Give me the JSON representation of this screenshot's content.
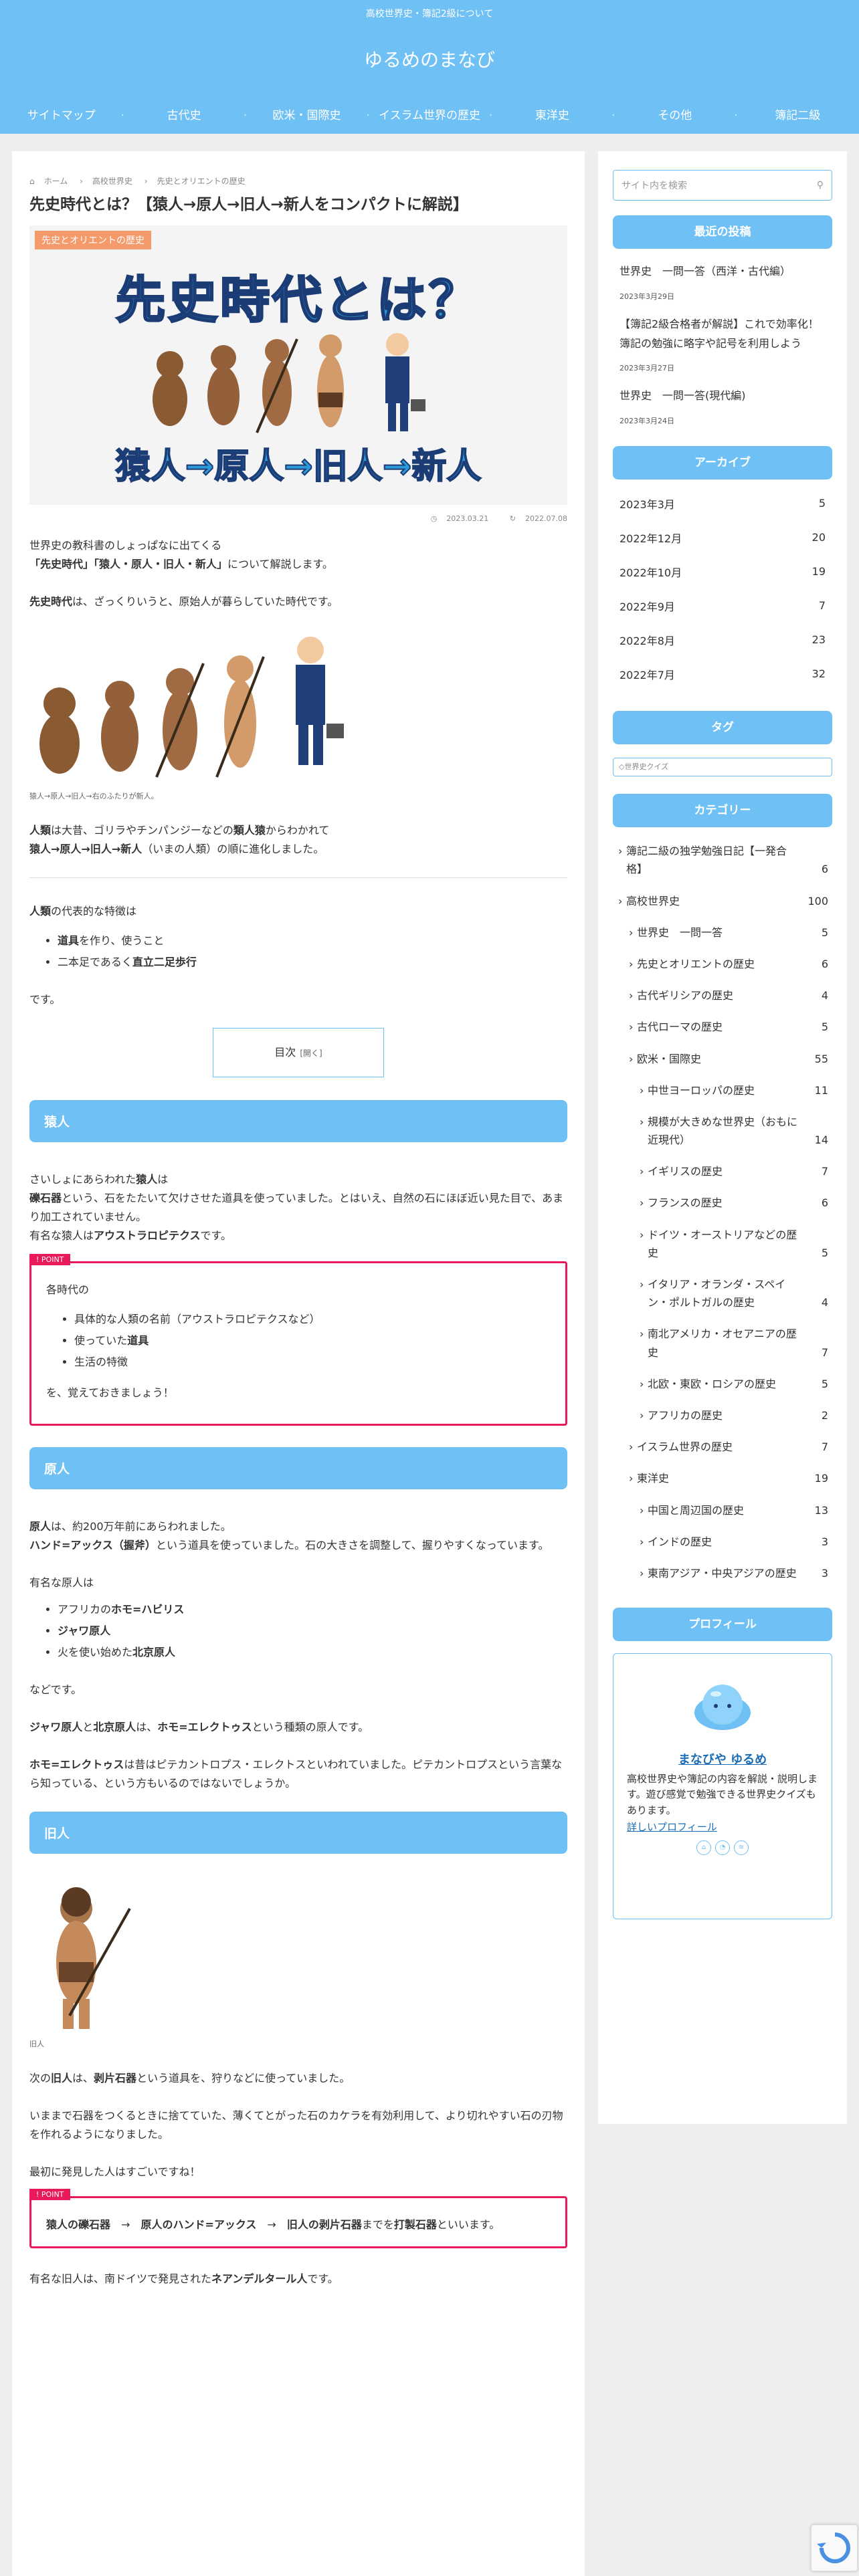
{
  "header": {
    "tagline": "高校世界史・簿記2級について",
    "site_title": "ゆるめのまなび",
    "nav": [
      "サイトマップ",
      "古代史",
      "欧米・国際史",
      "イスラム世界の歴史",
      "東洋史",
      "その他",
      "簿記二級"
    ]
  },
  "breadcrumb": [
    "ホーム",
    "高校世界史",
    "先史とオリエントの歴史"
  ],
  "article": {
    "title": "先史時代とは？【猿人→原人→旧人→新人をコンパクトに解説】",
    "eyecatch_category": "先史とオリエントの歴史",
    "eyecatch_line1": "先史時代とは？",
    "eyecatch_line2": "猿人→原人→旧人→新人",
    "published": "2023.03.21",
    "updated": "2022.07.08",
    "intro1": "世界史の教科書のしょっぱなに出てくる",
    "intro2_bold": "「先史時代」「猿人・原人・旧人・新人」",
    "intro2_rest": "について解説します。",
    "def_bold": "先史時代",
    "def_rest": "は、ざっくりいうと、原始人が暮らしていた時代です。",
    "evolution_caption": "猿人→原人→旧人→右のふたりが新人。",
    "jinrui_bold": "人類",
    "jinrui_mid": "は大昔、ゴリラやチンパンジーなどの",
    "ruijinen_bold": "類人猿",
    "jinrui_end": "からわかれて",
    "chain_bold": "猿人→原人→旧人→新人",
    "chain_rest": "（いまの人類）の順に進化しました。",
    "features_intro_bold": "人類",
    "features_intro_rest": "の代表的な特徴は",
    "features": [
      {
        "bold": "道具",
        "rest": "を作り、使うこと"
      },
      {
        "pre": "二本足であるく",
        "bold": "直立二足歩行",
        "rest": ""
      }
    ],
    "desu": "です。",
    "toc_label": "目次",
    "toc_open": "[開く]"
  },
  "saru": {
    "heading": "猿人",
    "p1_pre": "さいしょにあらわれた",
    "p1_bold": "猿人",
    "p1_post": "は",
    "p2_bold": "礫石器",
    "p2_rest": "という、石をたたいて欠けさせた道具を使っていました。とはいえ、自然の石にほぼ近い見た目で、あまり加工されていません。",
    "p3_pre": "有名な猿人は",
    "p3_bold": "アウストラロピテクス",
    "p3_post": "です。",
    "point_tag": "POINT",
    "point_intro": "各時代の",
    "point_items": [
      "具体的な人類の名前（アウストラロピテクスなど）",
      "使っていた",
      "生活の特徴"
    ],
    "point_item2_bold": "道具",
    "point_outro": "を、覚えておきましょう！"
  },
  "gen": {
    "heading": "原人",
    "p1_bold": "原人",
    "p1_rest": "は、約200万年前にあらわれました。",
    "p2_bold": "ハンド=アックス（握斧）",
    "p2_rest": "という道具を使っていました。石の大きさを調整して、握りやすくなっています。",
    "famous": "有名な原人は",
    "list": [
      {
        "pre": "アフリカの",
        "bold": "ホモ=ハビリス",
        "post": ""
      },
      {
        "pre": "",
        "bold": "ジャワ原人",
        "post": ""
      },
      {
        "pre": "火を使い始めた",
        "bold": "北京原人",
        "post": ""
      }
    ],
    "nado": "などです。",
    "p3_b1": "ジャワ原人",
    "p3_t1": "と",
    "p3_b2": "北京原人",
    "p3_t2": "は、",
    "p3_b3": "ホモ=エレクトゥス",
    "p3_t3": "という種類の原人です。",
    "p4_bold": "ホモ=エレクトゥス",
    "p4_rest": "は昔はピテカントロプス・エレクトスといわれていました。ピテカントロプスという言葉なら知っている、という方もいるのではないでしょうか。"
  },
  "kyu": {
    "heading": "旧人",
    "caption": "旧人",
    "p1_pre": "次の",
    "p1_b1": "旧人",
    "p1_mid": "は、",
    "p1_b2": "剥片石器",
    "p1_post": "という道具を、狩りなどに使っていました。",
    "p2": "いままで石器をつくるときに捨てていた、薄くてとがった石のカケラを有効利用して、より切れやすい石の刃物を作れるようになりました。",
    "p3": "最初に発見した人はすごいですね！",
    "point_tag": "POINT",
    "pt_b1": "猿人の礫石器",
    "pt_arrow": "→",
    "pt_b2": "原人のハンド=アックス",
    "pt_b3": "旧人の剥片石器",
    "pt_t1": "までを",
    "pt_b4": "打製石器",
    "pt_t2": "といいます。",
    "p4_pre": "有名な旧人は、南ドイツで発見された",
    "p4_bold": "ネアンデルタール人",
    "p4_post": "です。"
  },
  "sidebar": {
    "search_placeholder": "サイト内を検索",
    "recent_heading": "最近の投稿",
    "recent_posts": [
      {
        "title": "世界史　一問一答（西洋・古代編）",
        "date": "2023年3月29日"
      },
      {
        "title": "【簿記2級合格者が解説】これで効率化！簿記の勉強に略字や記号を利用しよう",
        "date": "2023年3月27日"
      },
      {
        "title": "世界史　一問一答(現代編)",
        "date": "2023年3月24日"
      }
    ],
    "archive_heading": "アーカイブ",
    "archives": [
      {
        "label": "2023年3月",
        "count": "5"
      },
      {
        "label": "2022年12月",
        "count": "20"
      },
      {
        "label": "2022年10月",
        "count": "19"
      },
      {
        "label": "2022年9月",
        "count": "7"
      },
      {
        "label": "2022年8月",
        "count": "23"
      },
      {
        "label": "2022年7月",
        "count": "32"
      }
    ],
    "tag_heading": "タグ",
    "tag_item": "世界史クイズ",
    "category_heading": "カテゴリー",
    "categories": [
      {
        "label": "簿記二級の独学勉強日記【一発合格】",
        "count": "6",
        "level": 0
      },
      {
        "label": "高校世界史",
        "count": "100",
        "level": 0
      },
      {
        "label": "世界史　一問一答",
        "count": "5",
        "level": 1
      },
      {
        "label": "先史とオリエントの歴史",
        "count": "6",
        "level": 1
      },
      {
        "label": "古代ギリシアの歴史",
        "count": "4",
        "level": 1
      },
      {
        "label": "古代ローマの歴史",
        "count": "5",
        "level": 1
      },
      {
        "label": "欧米・国際史",
        "count": "55",
        "level": 1
      },
      {
        "label": "中世ヨーロッパの歴史",
        "count": "11",
        "level": 2
      },
      {
        "label": "規模が大きめな世界史（おもに近現代）",
        "count": "14",
        "level": 2
      },
      {
        "label": "イギリスの歴史",
        "count": "7",
        "level": 2
      },
      {
        "label": "フランスの歴史",
        "count": "6",
        "level": 2
      },
      {
        "label": "ドイツ・オーストリアなどの歴史",
        "count": "5",
        "level": 2
      },
      {
        "label": "イタリア・オランダ・スペイン・ポルトガルの歴史",
        "count": "4",
        "level": 2
      },
      {
        "label": "南北アメリカ・オセアニアの歴史",
        "count": "7",
        "level": 2
      },
      {
        "label": "北欧・東欧・ロシアの歴史",
        "count": "5",
        "level": 2
      },
      {
        "label": "アフリカの歴史",
        "count": "2",
        "level": 2
      },
      {
        "label": "イスラム世界の歴史",
        "count": "7",
        "level": 1
      },
      {
        "label": "東洋史",
        "count": "19",
        "level": 1
      },
      {
        "label": "中国と周辺国の歴史",
        "count": "13",
        "level": 2
      },
      {
        "label": "インドの歴史",
        "count": "3",
        "level": 2
      },
      {
        "label": "東南アジア・中央アジアの歴史",
        "count": "3",
        "level": 2
      }
    ],
    "profile_heading": "プロフィール",
    "profile_name": "まなびや ゆるめ",
    "profile_bio": "高校世界史や簿記の内容を解説・説明します。遊び感覚で勉強できる世界史クイズもあります。",
    "profile_more": "詳しいプロフィール"
  },
  "colors": {
    "accent": "#6fc1f5",
    "point": "#e81a5a",
    "category_label": "#f59a6b"
  }
}
